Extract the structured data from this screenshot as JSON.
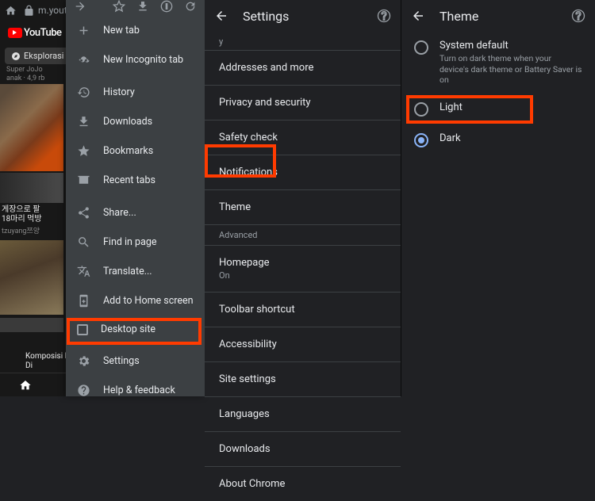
{
  "panel1": {
    "url_host": "m.yout",
    "yt_brand": "YouTube",
    "explore_chip": "Eksplorasi",
    "video_meta1_line1": "Super JoJo",
    "video_meta1_line2": "anak · 4,9 rb",
    "video2_title1": "게장으로 팔",
    "video2_title2": "18마리 먹방",
    "video2_channel": "tzuyang쯔양",
    "video4_title": "Komposisi Melodi Liyue | Genshin Impact: Di"
  },
  "menu": {
    "items": [
      "New tab",
      "New Incognito tab",
      "History",
      "Downloads",
      "Bookmarks",
      "Recent tabs",
      "Share...",
      "Find in page",
      "Translate...",
      "Add to Home screen",
      "Desktop site",
      "Settings",
      "Help & feedback"
    ]
  },
  "panel2": {
    "title": "Settings",
    "partial_top": "y",
    "items": {
      "addresses": "Addresses and more",
      "privacy": "Privacy and security",
      "safety": "Safety check",
      "notifications": "Notifications",
      "theme": "Theme",
      "advanced": "Advanced",
      "homepage": "Homepage",
      "homepage_sub": "On",
      "toolbar": "Toolbar shortcut",
      "a11y": "Accessibility",
      "site": "Site settings",
      "lang": "Languages",
      "downloads": "Downloads",
      "about": "About Chrome"
    }
  },
  "panel3": {
    "title": "Theme",
    "opts": {
      "sys": "System default",
      "sys_sub": "Turn on dark theme when your device's dark theme or Battery Saver is on",
      "light": "Light",
      "dark": "Dark"
    }
  }
}
